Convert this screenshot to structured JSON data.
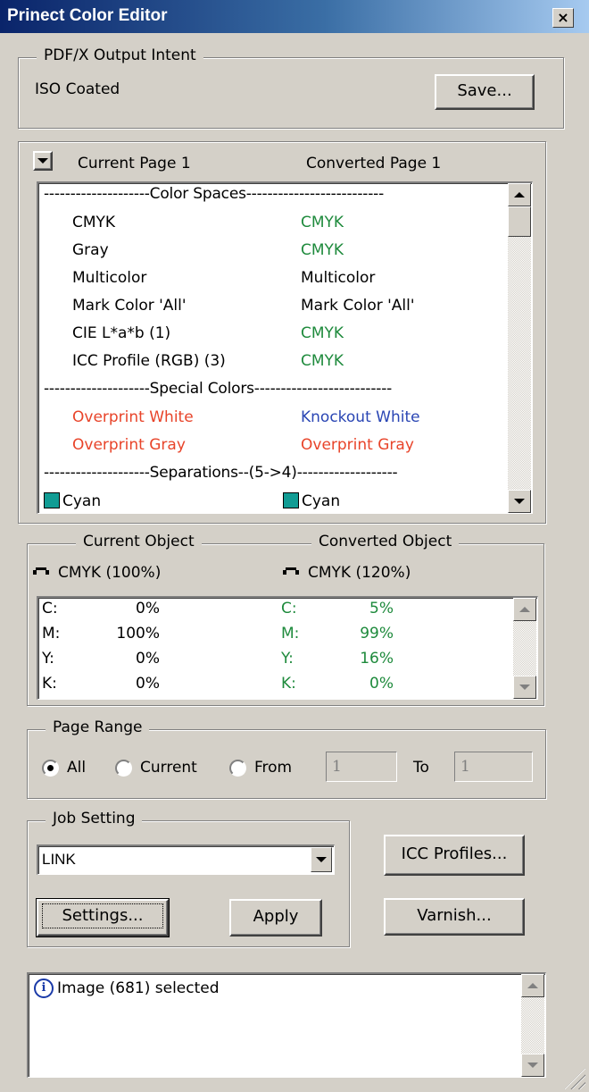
{
  "window": {
    "title": "Prinect Color Editor",
    "close_glyph": "×"
  },
  "output_intent": {
    "legend": "PDF/X Output Intent",
    "value": "ISO Coated",
    "save_label": "Save..."
  },
  "pages": {
    "current_label": "Current Page 1",
    "converted_label": "Converted Page 1",
    "color_spaces_header": "--------------------Color Spaces--------------------------",
    "color_spaces": [
      {
        "current": "CMYK",
        "converted": "CMYK",
        "converted_color": "green"
      },
      {
        "current": "Gray",
        "converted": "CMYK",
        "converted_color": "green"
      },
      {
        "current": "Multicolor",
        "converted": "Multicolor",
        "converted_color": "black"
      },
      {
        "current": "Mark Color 'All'",
        "converted": "Mark Color 'All'",
        "converted_color": "black"
      },
      {
        "current": "CIE L*a*b (1)",
        "converted": "CMYK",
        "converted_color": "green"
      },
      {
        "current": "ICC Profile (RGB) (3)",
        "converted": "CMYK",
        "converted_color": "green"
      }
    ],
    "special_colors_header": "--------------------Special Colors--------------------------",
    "special_colors": [
      {
        "current": "Overprint White",
        "current_color": "red",
        "converted": "Knockout White",
        "converted_color": "blue"
      },
      {
        "current": "Overprint Gray",
        "current_color": "red",
        "converted": "Overprint Gray",
        "converted_color": "red"
      }
    ],
    "separations_header": "--------------------Separations--(5->4)-------------------",
    "separations": [
      {
        "current": "Cyan",
        "converted": "Cyan",
        "swatch": "#119c94"
      }
    ]
  },
  "objects": {
    "current_legend": "Current Object",
    "converted_legend": "Converted Object",
    "current_mode": "CMYK (100%)",
    "converted_mode": "CMYK (120%)",
    "values": [
      {
        "label": "C:",
        "current": "0%",
        "converted": "5%"
      },
      {
        "label": "M:",
        "current": "100%",
        "converted": "99%"
      },
      {
        "label": "Y:",
        "current": "0%",
        "converted": "16%"
      },
      {
        "label": "K:",
        "current": "0%",
        "converted": "0%"
      }
    ]
  },
  "page_range": {
    "legend": "Page Range",
    "options": [
      "All",
      "Current",
      "From"
    ],
    "selected": "All",
    "from_value": "1",
    "to_label": "To",
    "to_value": "1"
  },
  "job_setting": {
    "legend": "Job Setting",
    "selected": "LINK",
    "settings_label": "Settings...",
    "apply_label": "Apply"
  },
  "side_buttons": {
    "icc_label": "ICC Profiles...",
    "varnish_label": "Varnish..."
  },
  "status": {
    "message": "Image (681) selected",
    "icon": "info-icon"
  },
  "colors": {
    "green": "#1e8a3c",
    "red": "#e8442a",
    "blue": "#2a46b4",
    "cyan_swatch": "#119c94"
  }
}
